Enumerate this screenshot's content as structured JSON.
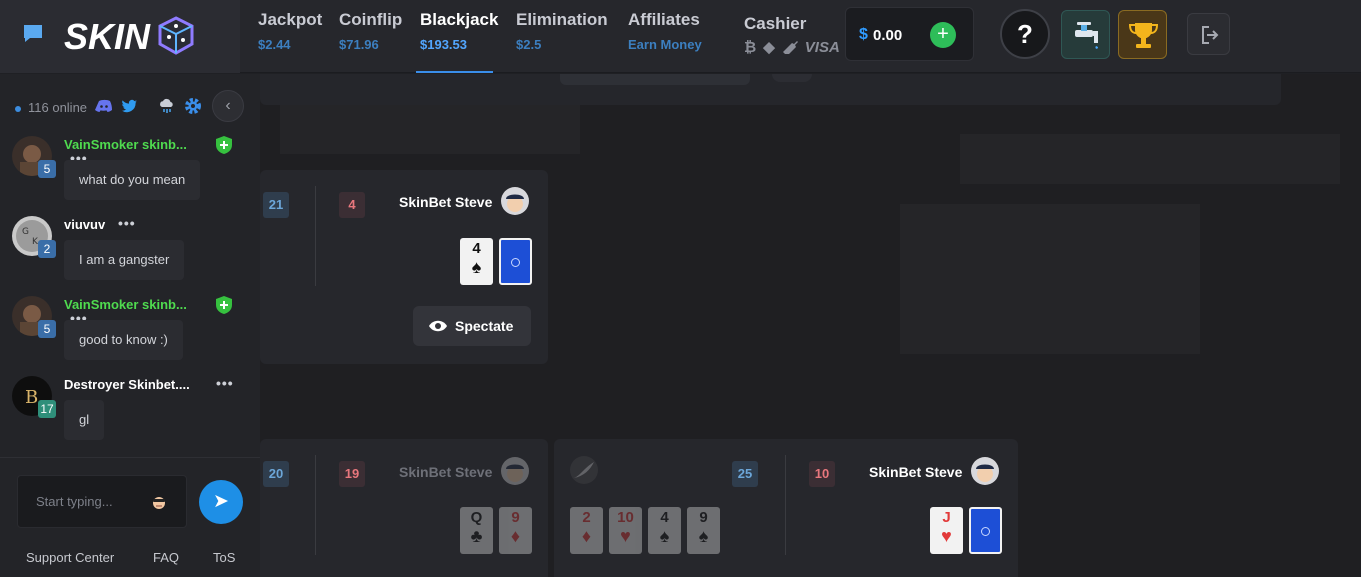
{
  "brand": {
    "logo_text": "SKIN"
  },
  "nav": [
    {
      "title": "Jackpot",
      "sub": "$2.44"
    },
    {
      "title": "Coinflip",
      "sub": "$71.96"
    },
    {
      "title": "Blackjack",
      "sub": "$193.53",
      "active": true
    },
    {
      "title": "Elimination",
      "sub": "$2.5"
    },
    {
      "title": "Affiliates",
      "sub": "Earn Money"
    }
  ],
  "cashier": {
    "title": "Cashier",
    "methods": [
      "bitcoin-icon",
      "ethereum-icon",
      "rifle-icon",
      "visa-icon"
    ],
    "visa_label": "VISA"
  },
  "balance": {
    "currency": "$",
    "amount": "0.00",
    "add_label": "+"
  },
  "help_label": "?",
  "sidebar": {
    "online_text": "116 online",
    "collapse_label": "‹",
    "messages": [
      {
        "user": "VainSmoker skinb...",
        "level": "5",
        "vip": true,
        "text": "what do you mean"
      },
      {
        "user": "viuvuv",
        "level": "2",
        "vip": false,
        "text": "I am a gangster"
      },
      {
        "user": "VainSmoker skinb...",
        "level": "5",
        "vip": true,
        "text": "good to know :)"
      },
      {
        "user": "Destroyer Skinbet....",
        "level": "17",
        "vip": false,
        "text": "gl"
      }
    ],
    "more_label": "•••",
    "input_placeholder": "Start typing...",
    "send_label": "➤",
    "footer": [
      "Support Center",
      "FAQ",
      "ToS"
    ]
  },
  "tables": {
    "top": {
      "left_score": "21",
      "right_score": "4",
      "dealer": "SkinBet Steve",
      "cards": [
        {
          "rank": "4",
          "suit": "♠",
          "color": "black"
        }
      ],
      "spectate_label": "Spectate"
    },
    "bottom_left": {
      "left_score": "20",
      "right_score": "19",
      "dealer": "SkinBet Steve",
      "cards": [
        {
          "rank": "Q",
          "suit": "♣",
          "color": "black"
        },
        {
          "rank": "9",
          "suit": "♦",
          "color": "red"
        }
      ]
    },
    "bottom_right": {
      "player_score": "25",
      "dealer_score": "10",
      "dealer": "SkinBet Steve",
      "player_cards": [
        {
          "rank": "2",
          "suit": "♦",
          "color": "red"
        },
        {
          "rank": "10",
          "suit": "♥",
          "color": "red"
        },
        {
          "rank": "4",
          "suit": "♠",
          "color": "black"
        },
        {
          "rank": "9",
          "suit": "♠",
          "color": "black"
        }
      ],
      "dealer_cards": [
        {
          "rank": "J",
          "suit": "♥",
          "color": "red"
        }
      ]
    }
  },
  "colors": {
    "accent": "#3a8eea",
    "vip": "#4fdb4f",
    "add": "#2ebd59",
    "send": "#1e8fe6"
  }
}
